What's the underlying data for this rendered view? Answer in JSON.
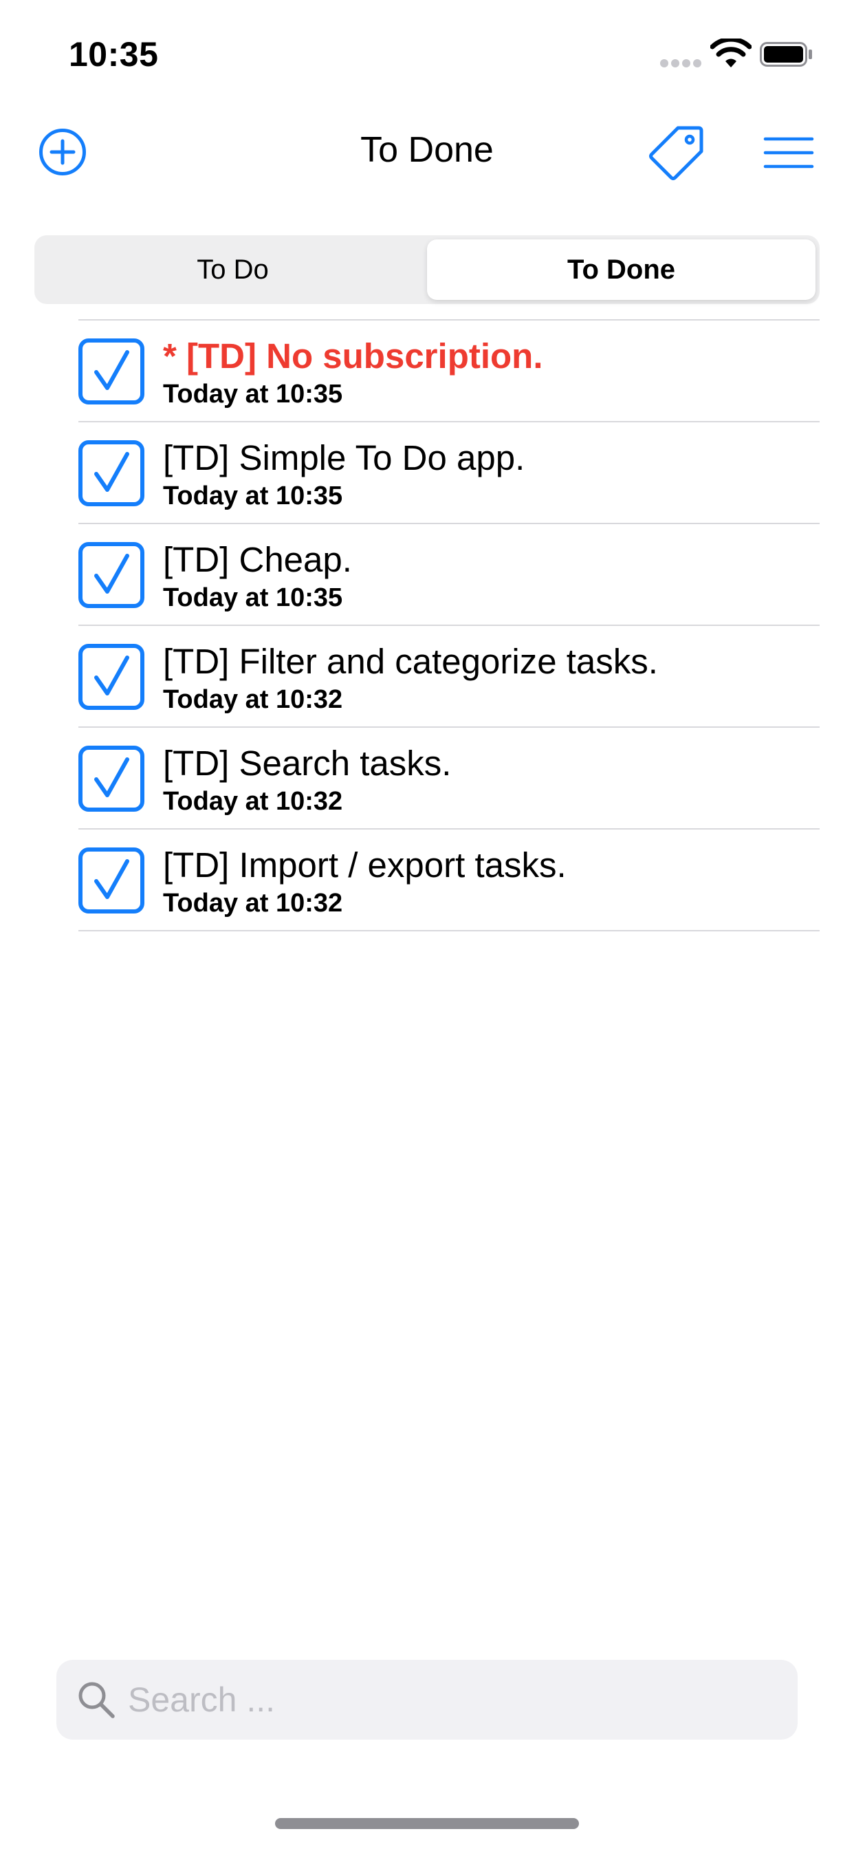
{
  "colors": {
    "accent": "#147efb",
    "highlight": "#ee3b30",
    "separator": "#d8d8dc"
  },
  "status_bar": {
    "time": "10:35"
  },
  "nav": {
    "title": "To Done",
    "icons": {
      "add": "plus-circle-icon",
      "tag": "tag-icon",
      "menu": "hamburger-menu-icon"
    }
  },
  "segments": [
    {
      "label": "To Do",
      "selected": false
    },
    {
      "label": "To Done",
      "selected": true
    }
  ],
  "tasks": [
    {
      "title": "* [TD] No subscription.",
      "date": "Today at 10:35",
      "done": true,
      "highlight": true
    },
    {
      "title": "[TD] Simple To Do app.",
      "date": "Today at 10:35",
      "done": true,
      "highlight": false
    },
    {
      "title": "[TD] Cheap.",
      "date": "Today at 10:35",
      "done": true,
      "highlight": false
    },
    {
      "title": "[TD] Filter and categorize tasks.",
      "date": "Today at 10:32",
      "done": true,
      "highlight": false
    },
    {
      "title": "[TD] Search tasks.",
      "date": "Today at 10:32",
      "done": true,
      "highlight": false
    },
    {
      "title": "[TD] Import / export tasks.",
      "date": "Today at 10:32",
      "done": true,
      "highlight": false
    }
  ],
  "search": {
    "placeholder": "Search ...",
    "value": ""
  }
}
